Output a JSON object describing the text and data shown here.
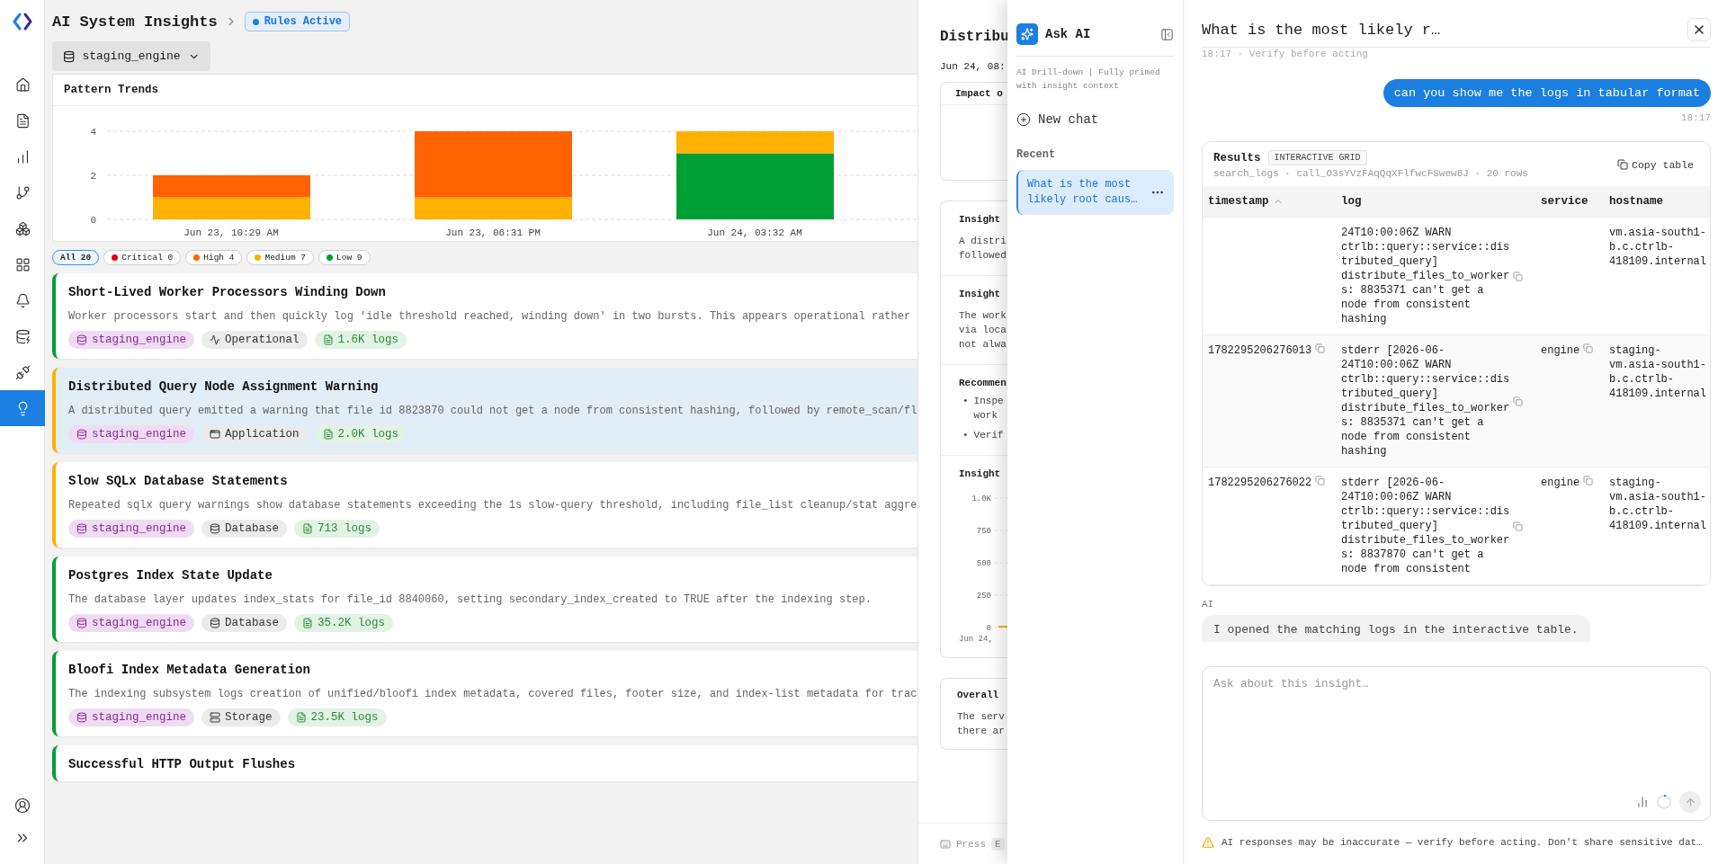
{
  "nav": {
    "items": [
      {
        "kind": "home",
        "selected": false
      },
      {
        "kind": "docs",
        "selected": false
      },
      {
        "kind": "metrics",
        "selected": false
      },
      {
        "kind": "pipelines",
        "selected": false
      },
      {
        "kind": "modules",
        "selected": false
      },
      {
        "kind": "dashboards",
        "selected": false
      },
      {
        "kind": "alerts",
        "selected": false
      },
      {
        "kind": "sources",
        "selected": false
      },
      {
        "kind": "connectors",
        "selected": false
      },
      {
        "kind": "insights",
        "selected": true
      }
    ]
  },
  "header": {
    "title": "AI System Insights",
    "badge": "Rules Active",
    "source": "staging_engine"
  },
  "trends": {
    "title": "Pattern Trends",
    "chart_data": {
      "type": "bar",
      "stacked": true,
      "categories": [
        "Jun 23, 10:29 AM",
        "Jun 23, 06:31 PM",
        "Jun 24, 03:32 AM"
      ],
      "ylim": [
        0,
        4
      ],
      "yticks": [
        0,
        2,
        4
      ],
      "series": [
        {
          "color": "#009f36",
          "values": [
            0,
            0,
            3
          ]
        },
        {
          "color": "#ffb000",
          "values": [
            1,
            1,
            1
          ]
        },
        {
          "color": "#ff6200",
          "values": [
            1,
            3,
            0
          ]
        }
      ]
    }
  },
  "filters": [
    {
      "label": "All",
      "count": "20",
      "selected": true
    },
    {
      "label": "Critical",
      "count": "0",
      "color": "#e4001b",
      "selected": false
    },
    {
      "label": "High",
      "count": "4",
      "color": "#ff6200",
      "selected": false
    },
    {
      "label": "Medium",
      "count": "7",
      "color": "#ffb000",
      "selected": false
    },
    {
      "label": "Low",
      "count": "9",
      "color": "#009f36",
      "selected": false
    }
  ],
  "insights": [
    {
      "title": "Short-Lived Worker Processors Winding Down",
      "description": "Worker processors start and then quickly log 'idle threshold reached, winding down' in two bursts. This appears operational rather",
      "color": "#009f36",
      "selected": false,
      "source": "staging_engine",
      "category": {
        "kind": "operational",
        "label": "Operational"
      },
      "logs": "1.6K logs"
    },
    {
      "title": "Distributed Query Node Assignment Warning",
      "description": "A distributed query emitted a warning that file id 8823870 could not get a node from consistent hashing, followed by remote_scan/fl",
      "color": "#ffb000",
      "selected": true,
      "source": "staging_engine",
      "category": {
        "kind": "application",
        "label": "Application"
      },
      "logs": "2.0K logs"
    },
    {
      "title": "Slow SQLx Database Statements",
      "description": "Repeated sqlx query warnings show database statements exceeding the 1s slow-query threshold, including file_list cleanup/stat aggre",
      "color": "#ffb000",
      "selected": false,
      "source": "staging_engine",
      "category": {
        "kind": "database",
        "label": "Database"
      },
      "logs": "713 logs"
    },
    {
      "title": "Postgres Index State Update",
      "description": "The database layer updates index_stats for file_id 8840060, setting secondary_index_created to TRUE after the indexing step.",
      "color": "#009f36",
      "selected": false,
      "source": "staging_engine",
      "category": {
        "kind": "database",
        "label": "Database"
      },
      "logs": "35.2K logs"
    },
    {
      "title": "Bloofi Index Metadata Generation",
      "description": "The indexing subsystem logs creation of unified/bloofi index metadata, covered files, footer size, and index-list metadata for trac",
      "color": "#009f36",
      "selected": false,
      "source": "staging_engine",
      "category": {
        "kind": "storage",
        "label": "Storage"
      },
      "logs": "23.5K logs"
    },
    {
      "title": "Successful HTTP Output Flushes",
      "color": "#009f36",
      "selected": false
    }
  ],
  "drawer": {
    "title": "Distribu",
    "timestamp": "Jun 24, 08:",
    "impact": "Impact o",
    "sections": [
      {
        "kind": "text",
        "title": "Insight",
        "text": "A distri followed"
      },
      {
        "kind": "text",
        "title": "Insight",
        "text": "The work via loca not alwa"
      },
      {
        "kind": "list",
        "title": "Recommen",
        "items": [
          {
            "marker": "•",
            "text": "Inspe work"
          },
          {
            "marker": "•",
            "text": "Verif"
          }
        ]
      },
      {
        "kind": "chart",
        "title": "Insight",
        "ticks": [
          "1.0K",
          "750",
          "500",
          "250",
          "0"
        ],
        "xlabel": "Jun 24,"
      }
    ],
    "overall": {
      "title": "Overall",
      "text": "The serv there ar"
    },
    "hint": {
      "label": "Press",
      "key": "E"
    }
  },
  "assistant": {
    "title": "Ask AI",
    "subtitle": "AI Drill-down | Fully primed with insight context",
    "new_chat": "New chat",
    "recent_title": "Recent",
    "recent": [
      {
        "title": "What is the most likely root caus…",
        "selected": true
      }
    ]
  },
  "chat": {
    "title": "What is the most likely r…",
    "subtitle": "18:17 · Verify before acting",
    "user": {
      "text": "can you show me the logs in tabular format",
      "time": "18:17"
    },
    "results": {
      "title": "Results",
      "badge": "INTERACTIVE GRID",
      "meta": "search_logs · call_O3sYVzFAqQqXFlfwcFSwew6J · 20 rows",
      "action": "Copy table",
      "columns": [
        {
          "label": "timestamp",
          "sorted": true
        },
        {
          "label": "log",
          "sorted": false
        },
        {
          "label": "service",
          "sorted": false
        },
        {
          "label": "hostname",
          "sorted": false
        }
      ],
      "rows": [
        {
          "log": "24T10:00:06Z WARN ctrlb::query::service::distributed_query] distribute_files_to_workers: 8835371 can't get a node from consistent hashing",
          "hostname": "vm.asia-south1-b.c.ctrlb-418109.internal"
        },
        {
          "timestamp": "1782295206276013",
          "log": "stderr [2026-06-24T10:00:06Z WARN ctrlb::query::service::distributed_query] distribute_files_to_workers: 8835371 can't get a node from consistent hashing",
          "service": "engine",
          "hostname": "staging-vm.asia-south1-b.c.ctrlb-418109.internal"
        },
        {
          "timestamp": "1782295206276022",
          "log": "stderr [2026-06-24T10:00:06Z WARN ctrlb::query::service::distributed_query] distribute_files_to_workers: 8837870 can't get a node from consistent",
          "service": "engine",
          "hostname": "staging-vm.asia-south1-b.c.ctrlb-418109.internal"
        }
      ]
    },
    "ai": {
      "author": "AI",
      "text": "I opened the matching logs in the interactive table."
    },
    "composer": {
      "placeholder": "Ask about this insight…"
    },
    "disclaimer": "AI responses may be inaccurate — verify before acting. Don't share sensitive dat…"
  }
}
